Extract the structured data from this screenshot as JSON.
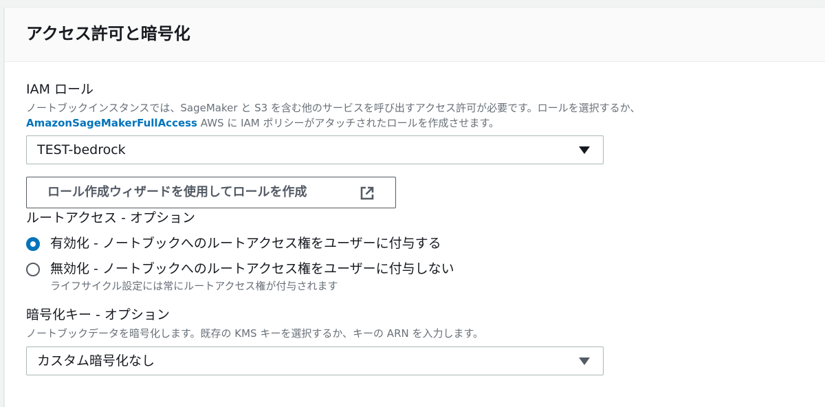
{
  "panel": {
    "title": "アクセス許可と暗号化"
  },
  "iam_role": {
    "label": "IAM ロール",
    "description_line1": "ノートブックインスタンスでは、SageMaker と S3 を含む他のサービスを呼び出すアクセス許可が必要です。ロールを選択するか、",
    "description_link": "AmazonSageMakerFullAccess",
    "description_line2_rest": " AWS に IAM ポリシーがアタッチされたロールを作成させます。",
    "selected_value": "TEST-bedrock",
    "create_button_label": "ロール作成ウィザードを使用してロールを作成",
    "external_link_icon": "external-link-icon"
  },
  "root_access": {
    "label": "ルートアクセス - オプション",
    "options": [
      {
        "label": "有効化 - ノートブックへのルートアクセス権をユーザーに付与する",
        "selected": true
      },
      {
        "label": "無効化 - ノートブックへのルートアクセス権をユーザーに付与しない",
        "description": "ライフサイクル設定には常にルートアクセス権が付与されます",
        "selected": false
      }
    ]
  },
  "encryption_key": {
    "label": "暗号化キー - オプション",
    "description": "ノートブックデータを暗号化します。既存の KMS キーを選択するか、キーの ARN を入力します。",
    "selected_value": "カスタム暗号化なし"
  },
  "colors": {
    "accent": "#0073bb",
    "text": "#16191f",
    "muted_text": "#687078",
    "border": "#aab7b8"
  }
}
